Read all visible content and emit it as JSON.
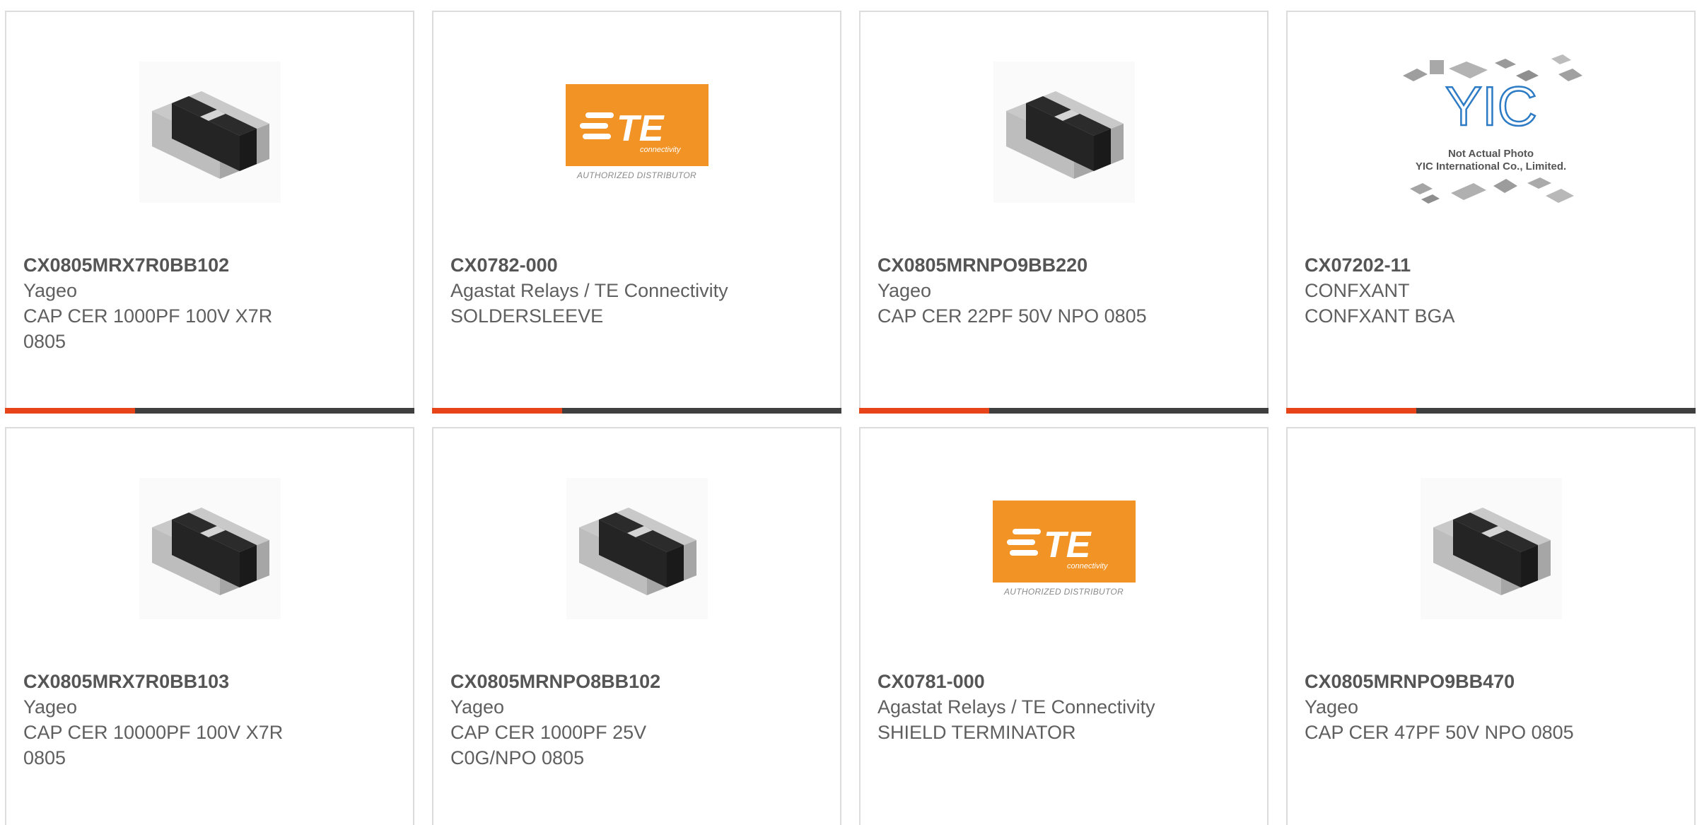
{
  "products": [
    {
      "part_number": "CX0805MRX7R0BB102",
      "manufacturer": "Yageo",
      "description": "CAP CER 1000PF 100V X7R 0805",
      "image": "chip-capacitor-icon"
    },
    {
      "part_number": "CX0782-000",
      "manufacturer": "Agastat Relays / TE Connectivity",
      "description": "SOLDERSLEEVE",
      "image": "te-connectivity-logo"
    },
    {
      "part_number": "CX0805MRNPO9BB220",
      "manufacturer": "Yageo",
      "description": "CAP CER 22PF 50V NPO 0805",
      "image": "chip-capacitor-icon"
    },
    {
      "part_number": "CX07202-11",
      "manufacturer": "CONFXANT",
      "description": "CONFXANT BGA",
      "image": "yic-placeholder"
    },
    {
      "part_number": "CX0805MRX7R0BB103",
      "manufacturer": "Yageo",
      "description": "CAP CER 10000PF 100V X7R 0805",
      "image": "chip-capacitor-icon"
    },
    {
      "part_number": "CX0805MRNPO8BB102",
      "manufacturer": "Yageo",
      "description": "CAP CER 1000PF 25V C0G/NPO 0805",
      "image": "chip-capacitor-icon"
    },
    {
      "part_number": "CX0781-000",
      "manufacturer": "Agastat Relays / TE Connectivity",
      "description": "SHIELD TERMINATOR",
      "image": "te-connectivity-logo"
    },
    {
      "part_number": "CX0805MRNPO9BB470",
      "manufacturer": "Yageo",
      "description": "CAP CER 47PF 50V NPO 0805",
      "image": "chip-capacitor-icon"
    }
  ],
  "te_logo": {
    "wordmark": "TE",
    "tagline": "connectivity",
    "distributor_text": "AUTHORIZED DISTRIBUTOR"
  },
  "yic_placeholder": {
    "logo_text": "YIC",
    "caption_line1": "Not Actual Photo",
    "caption_line2": "YIC International Co., Limited."
  },
  "colors": {
    "accent": "#e8441a",
    "accent_track": "#3f3f3f",
    "te_orange": "#f29325",
    "card_border": "#dcdcdc",
    "text": "#5f5f5f"
  }
}
